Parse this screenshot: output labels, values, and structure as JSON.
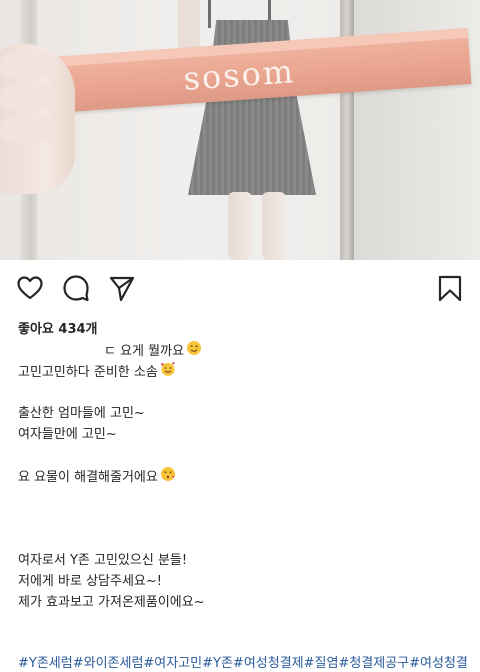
{
  "photo": {
    "brand_text": "sosom",
    "box_color": "#eaa690"
  },
  "actions": {
    "like_icon": "heart-icon",
    "comment_icon": "comment-icon",
    "share_icon": "send-icon",
    "save_icon": "bookmark-icon"
  },
  "likes": {
    "text": "좋아요 434개"
  },
  "caption": {
    "line1": "ㄷ 요게 뭘까요",
    "line1_emoji": "wink-emoji",
    "line2": "고민고민하다 준비한 소솜",
    "line2_emoji": "smiling-hearts-emoji",
    "line3": "출산한 엄마들에 고민~",
    "line4": "여자들만에 고민~",
    "line5": "요 요물이 해결해줄거에요",
    "line5_emoji": "kissing-heart-emoji",
    "line6": "여자로서 Y존 고민있으신 분들!",
    "line7": "저에게 바로 상담주세요~!",
    "line8": "제가 효과보고 가져온제품이에요~"
  },
  "hashtags": {
    "text": "#Y존세럼#와이존세럼#여자고민#Y존#여성청결제#질염#청결제공구#여성청결"
  },
  "colors": {
    "text": "#262626",
    "hashtag": "#2b5b9b"
  }
}
